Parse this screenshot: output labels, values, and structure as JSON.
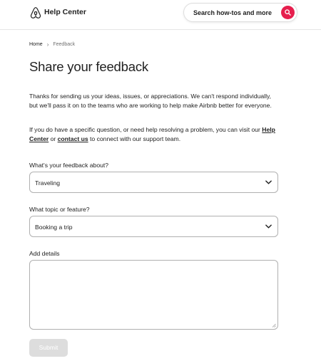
{
  "header": {
    "brand": "Help Center",
    "search_label": "Search how-tos and more"
  },
  "breadcrumb": {
    "home": "Home",
    "current": "Feedback"
  },
  "page": {
    "title": "Share your feedback",
    "intro": "Thanks for sending us your ideas, issues, or appreciations. We can't respond individually, but we'll pass it on to the teams who are working to help make Airbnb better for everyone.",
    "intro2_prefix": "If you do have a specific question, or need help resolving a problem, you can visit our ",
    "help_center_link": "Help Center",
    "intro2_or": " or ",
    "contact_link": "contact us",
    "intro2_suffix": " to connect with our support team."
  },
  "form": {
    "feedback_about_label": "What's your feedback about?",
    "feedback_about_value": "Traveling",
    "topic_label": "What topic or feature?",
    "topic_value": "Booking a trip",
    "details_label": "Add details",
    "details_value": "",
    "submit_label": "Submit"
  },
  "colors": {
    "brand": "#e61e4d",
    "submit_disabled": "#dddddd"
  }
}
